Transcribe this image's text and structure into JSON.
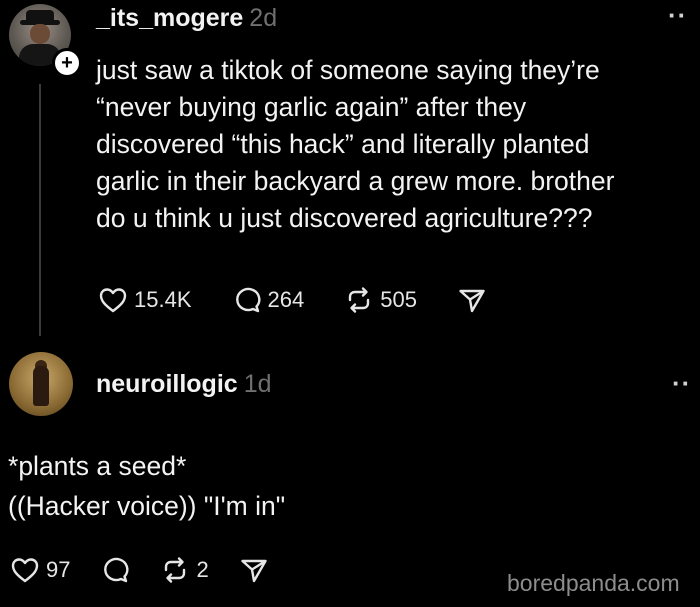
{
  "post": {
    "username": "_its_mogere",
    "time": "2d",
    "more": "··",
    "follow_symbol": "+",
    "text": "just saw a tiktok of someone saying they’re\n“never buying garlic again” after they\ndiscovered “this hack” and literally planted\ngarlic in their backyard a grew more. brother\ndo u think u just discovered agriculture???",
    "likes": "15.4K",
    "comments": "264",
    "reposts": "505"
  },
  "reply": {
    "username": "neuroillogic",
    "time": "1d",
    "more": "··",
    "text": "*plants a seed*\n((Hacker voice)) \"I'm in\"",
    "likes": "97",
    "reposts": "2"
  },
  "watermark": "boredpanda.com",
  "icons": [
    "heart-icon",
    "comment-icon",
    "repost-icon",
    "share-icon",
    "plus-icon",
    "more-icon"
  ]
}
